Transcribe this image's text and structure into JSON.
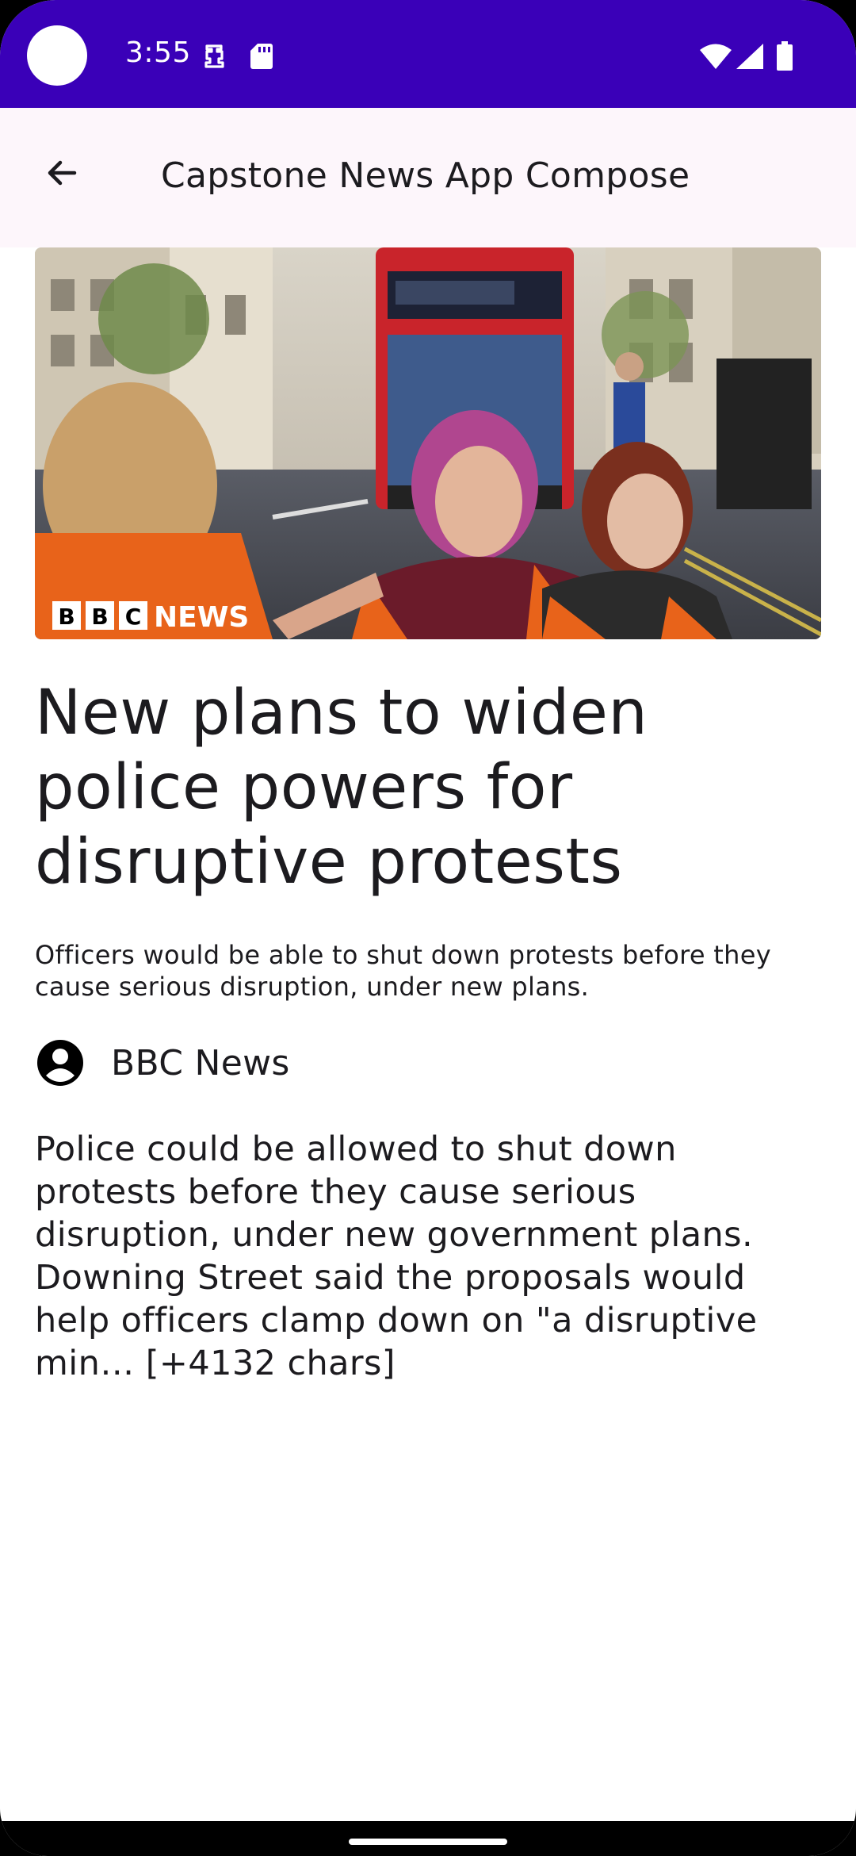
{
  "status_bar": {
    "time": "3:55"
  },
  "app_bar": {
    "title": "Capstone News App Compose"
  },
  "article": {
    "image_watermark": "BBC NEWS",
    "headline": "New plans to widen police powers for disruptive protests",
    "description": "Officers would be able to shut down protests before they cause serious disruption, under new plans.",
    "source": "BBC News",
    "content": "Police could be allowed to shut down protests before they cause serious disruption, under new government plans. Downing Street said the proposals would help officers clamp down on \"a disruptive min… [+4132 chars]"
  },
  "colors": {
    "status_bar": "#3a00b8",
    "app_bar": "#fdf6fb",
    "text": "#1c1b1f"
  }
}
